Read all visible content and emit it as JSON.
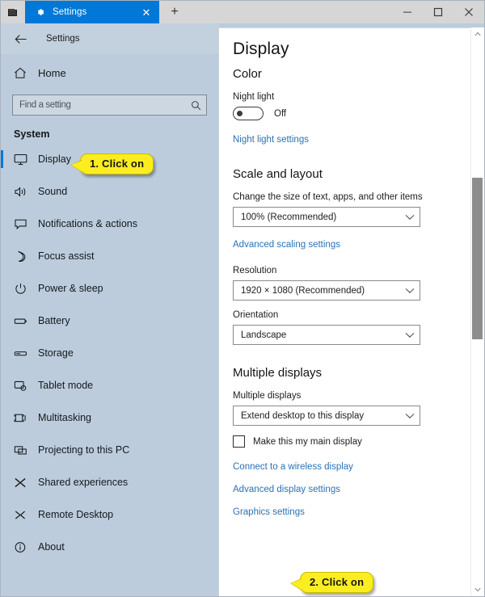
{
  "window": {
    "system_icon": "app-window-icon",
    "tab": {
      "label": "Settings",
      "icon": "gear-icon",
      "close": "✕"
    },
    "new_tab": "+",
    "controls": {
      "minimize": "─",
      "maximize": "❐",
      "close": "✕"
    }
  },
  "nav": {
    "back": "←",
    "header_title": "Settings",
    "home": {
      "label": "Home",
      "icon": "home-icon"
    },
    "search": {
      "placeholder": "Find a setting",
      "value": "",
      "icon": "search-icon"
    },
    "group_title": "System",
    "items": [
      {
        "label": "Display",
        "icon": "monitor-icon",
        "selected": true
      },
      {
        "label": "Sound",
        "icon": "speaker-icon",
        "selected": false
      },
      {
        "label": "Notifications & actions",
        "icon": "notification-icon",
        "selected": false
      },
      {
        "label": "Focus assist",
        "icon": "moon-icon",
        "selected": false
      },
      {
        "label": "Power & sleep",
        "icon": "power-icon",
        "selected": false
      },
      {
        "label": "Battery",
        "icon": "battery-icon",
        "selected": false
      },
      {
        "label": "Storage",
        "icon": "storage-icon",
        "selected": false
      },
      {
        "label": "Tablet mode",
        "icon": "tablet-icon",
        "selected": false
      },
      {
        "label": "Multitasking",
        "icon": "multitasking-icon",
        "selected": false
      },
      {
        "label": "Projecting to this PC",
        "icon": "projecting-icon",
        "selected": false
      },
      {
        "label": "Shared experiences",
        "icon": "shared-icon",
        "selected": false
      },
      {
        "label": "Remote Desktop",
        "icon": "remote-desktop-icon",
        "selected": false
      },
      {
        "label": "About",
        "icon": "info-icon",
        "selected": false
      }
    ]
  },
  "main": {
    "page_title": "Display",
    "color": {
      "section_title": "Color",
      "night_light_label": "Night light",
      "night_light_state": "Off",
      "night_light_on": false,
      "night_light_settings_link": "Night light settings"
    },
    "scale_and_layout": {
      "section_title": "Scale and layout",
      "scale_label": "Change the size of text, apps, and other items",
      "scale_value": "100% (Recommended)",
      "advanced_scaling_link": "Advanced scaling settings",
      "resolution_label": "Resolution",
      "resolution_value": "1920 × 1080 (Recommended)",
      "orientation_label": "Orientation",
      "orientation_value": "Landscape"
    },
    "multiple_displays": {
      "section_title": "Multiple displays",
      "field_label": "Multiple displays",
      "value": "Extend desktop to this display",
      "main_display_checkbox_label": "Make this my main display",
      "main_display_checked": false,
      "links": [
        "Connect to a wireless display",
        "Advanced display settings",
        "Graphics settings"
      ]
    }
  },
  "scrollbar": {
    "up_arrow": "▲",
    "down_arrow": "▼"
  },
  "callouts": [
    {
      "text": "1. Click on"
    },
    {
      "text": "2. Click on"
    }
  ],
  "colors": {
    "accent": "#0078d7",
    "nav_background": "#bcccdc",
    "link": "#2a72b5",
    "callout_fill": "#fbed1f"
  }
}
